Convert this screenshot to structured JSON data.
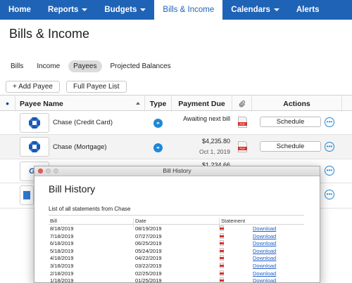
{
  "nav": {
    "items": [
      {
        "label": "Home",
        "caret": false,
        "active": false
      },
      {
        "label": "Reports",
        "caret": true,
        "active": false
      },
      {
        "label": "Budgets",
        "caret": true,
        "active": false
      },
      {
        "label": "Bills & Income",
        "caret": false,
        "active": true
      },
      {
        "label": "Calendars",
        "caret": true,
        "active": false
      },
      {
        "label": "Alerts",
        "caret": false,
        "active": false
      }
    ]
  },
  "page": {
    "title": "Bills & Income"
  },
  "subtabs": [
    {
      "label": "Bills",
      "active": false
    },
    {
      "label": "Income",
      "active": false
    },
    {
      "label": "Payees",
      "active": true
    },
    {
      "label": "Projected Balances",
      "active": false
    }
  ],
  "toolbar": {
    "add_payee": "+ Add Payee",
    "full_list": "Full Payee List"
  },
  "grid": {
    "headers": {
      "bullet": "•",
      "payee": "Payee Name",
      "type": "Type",
      "due": "Payment Due",
      "actions": "Actions"
    },
    "rows": [
      {
        "name": "Chase (Credit Card)",
        "logo": "chase-logo",
        "due_amount": "Awaiting next bill",
        "due_date": "",
        "action": "Schedule"
      },
      {
        "name": "Chase (Mortgage)",
        "logo": "chase-logo",
        "due_amount": "$4,235.80",
        "due_date": "Oct 1, 2019",
        "action": "Schedule"
      },
      {
        "name": "",
        "logo": "ge-logo",
        "due_amount": "$1,234.66",
        "due_date": "",
        "action": ""
      },
      {
        "name": "",
        "logo": "generic-logo",
        "due_amount": "",
        "due_date": "",
        "action": ""
      }
    ]
  },
  "modal": {
    "window_title": "Bill History",
    "heading": "Bill History",
    "caption": "List of all statements from Chase",
    "columns": {
      "bill": "Bill",
      "date": "Date",
      "statement": "Statement"
    },
    "link_label": "Download",
    "rows": [
      {
        "bill": "8/18/2019",
        "date": "08/19/2019"
      },
      {
        "bill": "7/18/2019",
        "date": "07/27/2019"
      },
      {
        "bill": "6/18/2019",
        "date": "06/25/2019"
      },
      {
        "bill": "5/18/2019",
        "date": "05/24/2019"
      },
      {
        "bill": "4/18/2019",
        "date": "04/22/2019"
      },
      {
        "bill": "3/18/2019",
        "date": "03/22/2019"
      },
      {
        "bill": "2/18/2019",
        "date": "02/25/2019"
      },
      {
        "bill": "1/18/2019",
        "date": "01/25/2019"
      }
    ]
  },
  "colors": {
    "nav_bg": "#1f63b6",
    "accent_blue": "#1e88d6",
    "link": "#1f5fcc",
    "pdf_red": "#d9302a"
  }
}
